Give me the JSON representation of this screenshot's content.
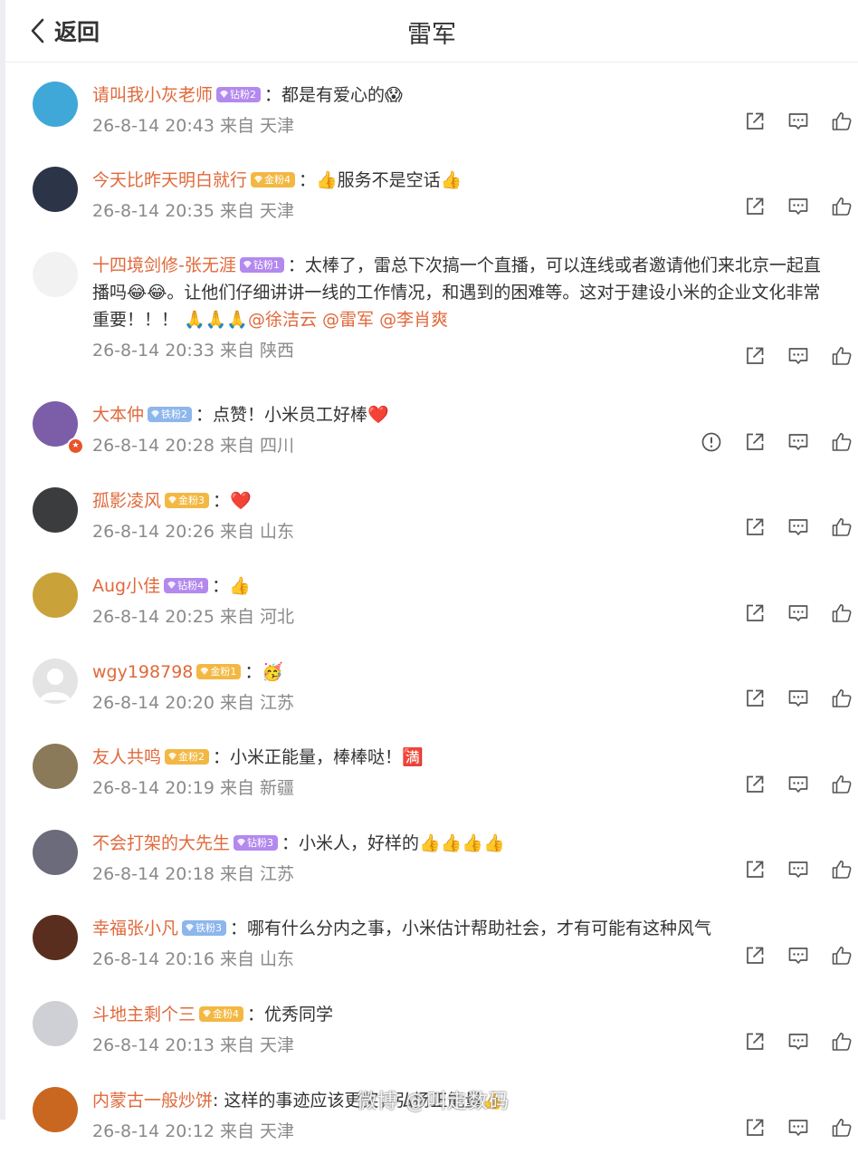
{
  "header": {
    "back_label": "返回",
    "title": "雷军"
  },
  "comments": [
    {
      "nick": "请叫我小灰老师",
      "badge": "钻粉2",
      "badge_type": "zuan",
      "text": "：都是有爱心的😱",
      "mentions": "",
      "meta": "26-8-14 20:43 来自 天津",
      "avatar_color": "#3fa8d8",
      "report": false
    },
    {
      "nick": "今天比昨天明白就行",
      "badge": "金粉4",
      "badge_type": "jin",
      "text": "：👍服务不是空话👍",
      "mentions": "",
      "meta": "26-8-14 20:35 来自 天津",
      "avatar_color": "#2c3448",
      "report": false
    },
    {
      "nick": "十四境剑修-张无涯",
      "badge": "钻粉1",
      "badge_type": "zuan",
      "text": "：太棒了，雷总下次搞一个直播，可以连线或者邀请他们来北京一起直播吗😂😂。让他们仔细讲讲一线的工作情况，和遇到的困难等。这对于建设小米的企业文化非常重要！！！ 🙏🙏🙏",
      "mentions": "@徐洁云 @雷军 @李肖爽",
      "meta": "26-8-14 20:33 来自 陕西",
      "avatar_color": "#f2f2f2",
      "report": false
    },
    {
      "nick": "大本仲",
      "badge": "铁粉2",
      "badge_type": "tie",
      "text": "：点赞！小米员工好棒❤️",
      "mentions": "",
      "meta": "26-8-14 20:28 来自 四川",
      "avatar_color": "#7b5ea7",
      "report": true
    },
    {
      "nick": "孤影凌风",
      "badge": "金粉3",
      "badge_type": "jin",
      "text": "：❤️",
      "mentions": "",
      "meta": "26-8-14 20:26 来自 山东",
      "avatar_color": "#3a3c3e",
      "report": false
    },
    {
      "nick": "Aug小佳",
      "badge": "钻粉4",
      "badge_type": "zuan",
      "text": "：👍",
      "mentions": "",
      "meta": "26-8-14 20:25 来自 河北",
      "avatar_color": "#c9a23a",
      "report": false
    },
    {
      "nick": "wgy198798",
      "badge": "金粉1",
      "badge_type": "jin",
      "text": "：🥳",
      "mentions": "",
      "meta": "26-8-14 20:20 来自 江苏",
      "avatar_color": "#e4e4e4",
      "report": false
    },
    {
      "nick": "友人共鸣",
      "badge": "金粉2",
      "badge_type": "jin",
      "text": "：小米正能量，棒棒哒！🈵",
      "mentions": "",
      "meta": "26-8-14 20:19 来自 新疆",
      "avatar_color": "#8a7a5a",
      "report": false
    },
    {
      "nick": "不会打架的大先生",
      "badge": "钻粉3",
      "badge_type": "zuan",
      "text": "：小米人，好样的👍👍👍👍",
      "mentions": "",
      "meta": "26-8-14 20:18 来自 江苏",
      "avatar_color": "#6b6b7b",
      "report": false
    },
    {
      "nick": "幸福张小凡",
      "badge": "铁粉3",
      "badge_type": "tie",
      "text": "：哪有什么分内之事，小米估计帮助社会，才有可能有这种风气",
      "mentions": "",
      "meta": "26-8-14 20:16 来自 山东",
      "avatar_color": "#5a2e1e",
      "report": false
    },
    {
      "nick": "斗地主剩个三",
      "badge": "金粉4",
      "badge_type": "jin",
      "text": "：优秀同学",
      "mentions": "",
      "meta": "26-8-14 20:13 来自 天津",
      "avatar_color": "#cfcfd6",
      "report": false
    },
    {
      "nick": "内蒙古一般炒饼",
      "badge": "",
      "badge_type": "",
      "text": ": 这样的事迹应该更奖，弘扬正能量👍",
      "mentions": "",
      "meta": "26-8-14 20:12 来自 天津",
      "avatar_color": "#c9661f",
      "report": false
    }
  ],
  "watermark": "微博 @叫走数码",
  "colors": {
    "nick": "#e0693b",
    "meta": "#8a8a8a",
    "zuan": "#b389ee",
    "jin": "#f3b843",
    "tie": "#8db6ec"
  }
}
